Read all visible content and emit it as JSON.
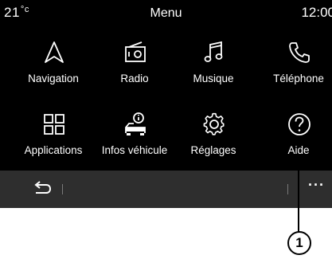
{
  "status": {
    "temperature": "21",
    "temperature_unit": "°c",
    "title": "Menu",
    "time": "12:00"
  },
  "tiles": [
    {
      "label": "Navigation",
      "icon": "navigation-icon"
    },
    {
      "label": "Radio",
      "icon": "radio-icon"
    },
    {
      "label": "Musique",
      "icon": "music-note-icon"
    },
    {
      "label": "Téléphone",
      "icon": "phone-icon"
    },
    {
      "label": "Applications",
      "icon": "apps-grid-icon"
    },
    {
      "label": "Infos véhicule",
      "icon": "vehicle-info-icon"
    },
    {
      "label": "Réglages",
      "icon": "gear-icon"
    },
    {
      "label": "Aide",
      "icon": "help-icon"
    }
  ],
  "bottom_bar": {
    "back_icon": "back-arrow-icon",
    "more_label": "···"
  },
  "callout": {
    "number": "1"
  }
}
